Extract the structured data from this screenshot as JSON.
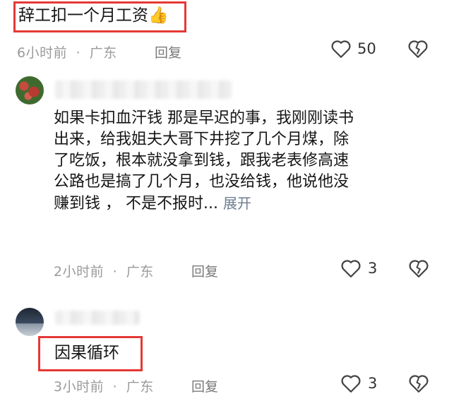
{
  "comments": [
    {
      "text": "辞工扣一个月工资",
      "emoji": "👍",
      "time": "6小时前",
      "location": "广东",
      "reply_label": "回复",
      "likes": "50"
    },
    {
      "lines": [
        "如果卡扣血汗钱 那是早迟的事，我刚刚读书",
        "出来，给我姐夫大哥下井挖了几个月煤，除",
        "了吃饭，根本就没拿到钱，跟我老表修高速",
        "公路也是搞了几个月，也没给钱，他说他没",
        "赚到钱 ， 不是不报时..."
      ],
      "expand_label": "展开",
      "time": "2小时前",
      "location": "广东",
      "reply_label": "回复",
      "likes": "3"
    },
    {
      "text": "因果循环",
      "time": "3小时前",
      "location": "广东",
      "reply_label": "回复",
      "likes": "3"
    }
  ],
  "separator": "·",
  "colors": {
    "highlight_border": "#e53935",
    "meta_gray": "#9a9a9a",
    "expand_blue": "#6d7d8f"
  }
}
